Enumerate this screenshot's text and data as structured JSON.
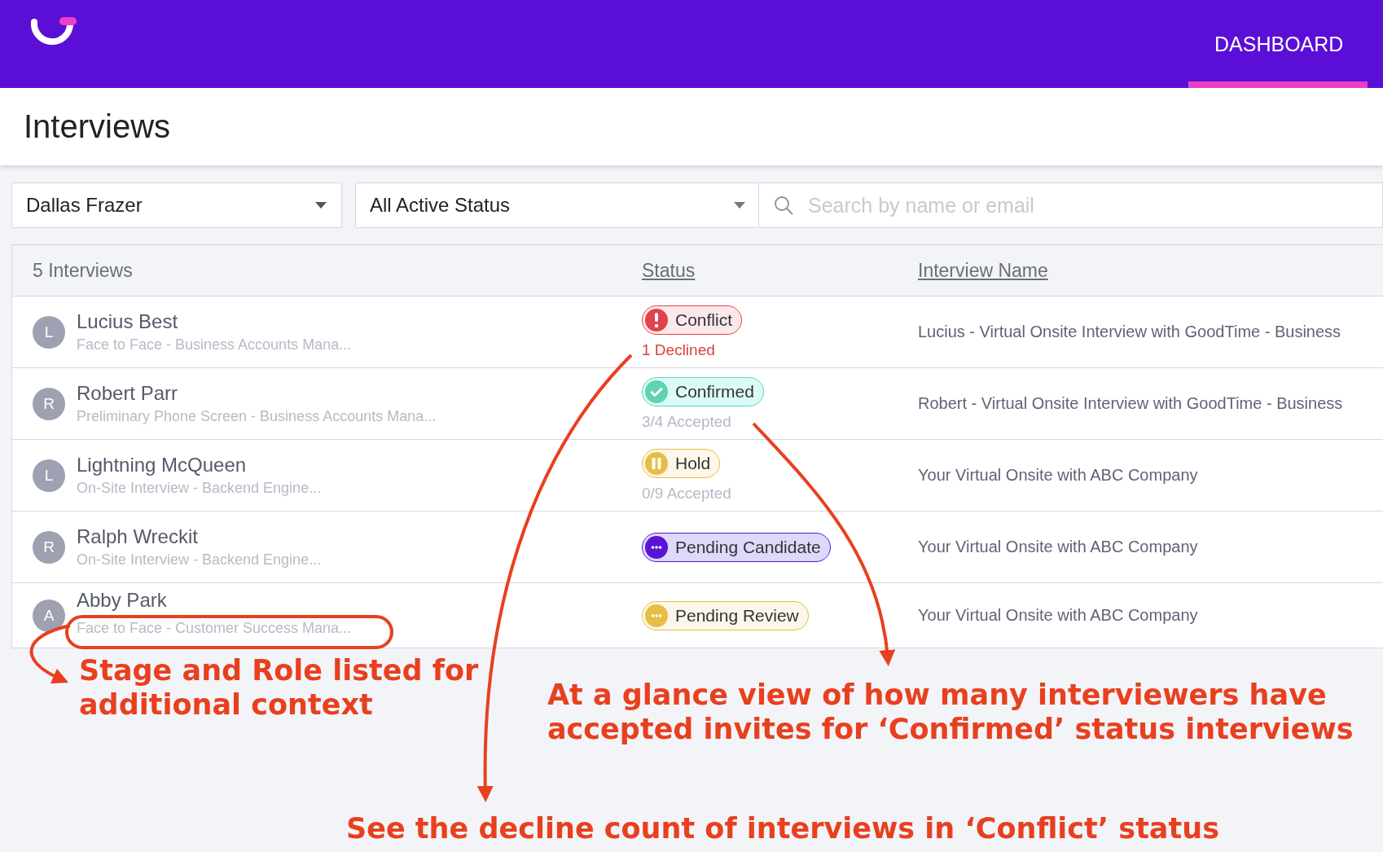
{
  "header": {
    "nav": [
      {
        "label": "DASHBOARD",
        "selected": true
      }
    ]
  },
  "page_title": "Interviews",
  "filters": {
    "recruiter": "Dallas Frazer",
    "status": "All Active Status",
    "search": {
      "placeholder": "Search by name or email"
    }
  },
  "table": {
    "count": "5 Interviews",
    "columns": [
      "Status",
      "Interview Name"
    ],
    "rows": [
      {
        "avatar": "L",
        "name": "Lucius Best",
        "stage": "Face to Face - Business Accounts Mana...",
        "status": {
          "kind": "conflict",
          "label": "Conflict"
        },
        "note": "1 Declined",
        "interview": "Lucius - Virtual Onsite Interview with GoodTime - Business"
      },
      {
        "avatar": "R",
        "name": "Robert Parr",
        "stage": "Preliminary Phone Screen - Business Accounts Mana...",
        "status": {
          "kind": "confirmed",
          "label": "Confirmed"
        },
        "note": "3/4 Accepted",
        "interview": "Robert - Virtual Onsite Interview with GoodTime - Business"
      },
      {
        "avatar": "L",
        "name": "Lightning McQueen",
        "stage": "On-Site Interview - Backend Engine...",
        "status": {
          "kind": "hold",
          "label": "Hold"
        },
        "note": "0/9 Accepted",
        "interview": "Your Virtual Onsite with ABC Company"
      },
      {
        "avatar": "R",
        "name": "Ralph Wreckit",
        "stage": "On-Site Interview - Backend Engine...",
        "status": {
          "kind": "pending_candidate",
          "label": "Pending Candidate"
        },
        "interview": "Your Virtual Onsite with ABC Company"
      },
      {
        "avatar": "A",
        "name": "Abby Park",
        "stage": "Face to Face - Customer Success Mana...",
        "status": {
          "kind": "pending_review",
          "label": "Pending Review"
        },
        "interview": "Your Virtual Onsite with ABC Company"
      }
    ]
  },
  "annotations": [
    "Stage and Role listed for additional context",
    "At a glance view of how many interviewers have accepted invites for ‘Confirmed’ status interviews",
    "See the decline count of interviews in ‘Conflict’ status"
  ]
}
